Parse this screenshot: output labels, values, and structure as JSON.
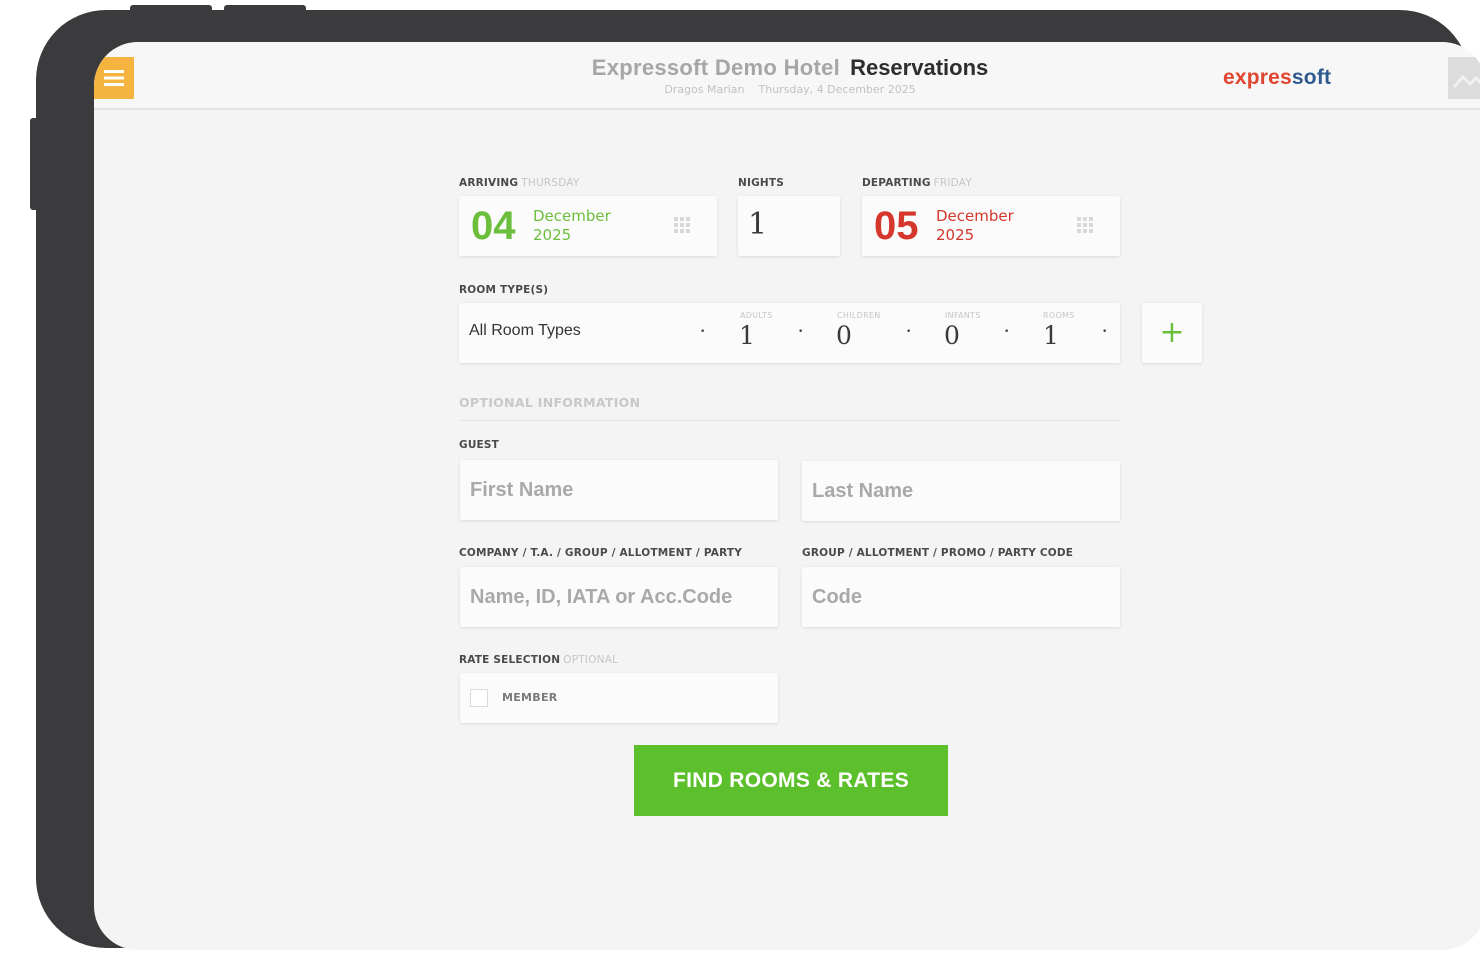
{
  "header": {
    "hotel_name": "Expressoft Demo Hotel",
    "page_title": "Reservations",
    "user_name": "Dragos Marian",
    "current_date": "Thursday, 4 December 2025",
    "brand_part1": "expres",
    "brand_part2": "soft",
    "menu_icon": "menu-icon",
    "user_icon": "avatar-image"
  },
  "arrival": {
    "label": "ARRIVING",
    "weekday": "THURSDAY",
    "day": "04",
    "month": "December",
    "year": "2025",
    "color": "#6cbf3c"
  },
  "nights": {
    "label": "NIGHTS",
    "value": "1"
  },
  "departure": {
    "label": "DEPARTING",
    "weekday": "FRIDAY",
    "day": "05",
    "month": "December",
    "year": "2025",
    "color": "#d6372c"
  },
  "rooms": {
    "label": "ROOM TYPE(S)",
    "room_type": "All Room Types",
    "adults_label": "ADULTS",
    "adults": "1",
    "children_label": "CHILDREN",
    "children": "0",
    "infants_label": "INFANTS",
    "infants": "0",
    "rooms_label": "ROOMS",
    "rooms_count": "1",
    "dropdown_arrow": "•",
    "add_icon": "+"
  },
  "optional": {
    "section_title": "OPTIONAL INFORMATION",
    "guest_label": "GUEST",
    "first_name_placeholder": "First Name",
    "last_name_placeholder": "Last Name",
    "company_label": "COMPANY / T.A. / GROUP / ALLOTMENT / PARTY",
    "company_placeholder": "Name, ID, IATA or Acc.Code",
    "code_label": "GROUP / ALLOTMENT / PROMO / PARTY CODE",
    "code_placeholder": "Code",
    "rate_label": "RATE SELECTION",
    "rate_label_note": "OPTIONAL",
    "member_option": "MEMBER"
  },
  "actions": {
    "find_label": "FIND ROOMS & RATES",
    "accent_color": "#5cc02d"
  }
}
